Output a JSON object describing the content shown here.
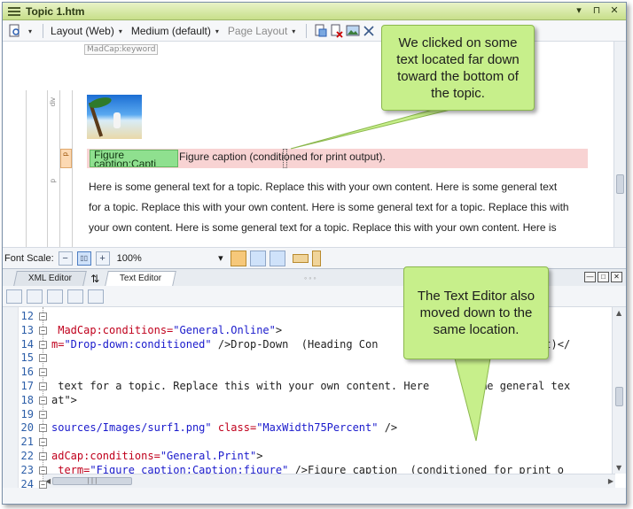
{
  "window": {
    "title": "Topic 1.htm",
    "controls": {
      "dropdown": "▾",
      "pin": "⊓",
      "close": "✕"
    }
  },
  "toolbar": {
    "layout": "Layout (Web)",
    "medium": "Medium (default)",
    "page_layout": "Page Layout"
  },
  "wysiwyg": {
    "keyword_tag": "MadCap:keyword",
    "struct_tags": [
      "div",
      "p",
      "p"
    ],
    "caption_label": "Figure caption;Capti",
    "caption_text": "Figure caption (conditioned for print output).",
    "body_lines": [
      "Here is some general text for a topic. Replace this with your own content. Here is some general text",
      "for a topic. Replace this with your own content. Here is some general text for a topic. Replace this with",
      "your own content. Here is some general text for a topic. Replace this with your own content. Here is"
    ]
  },
  "scalebar": {
    "label": "Font Scale:",
    "zoom": "100%",
    "minus": "−",
    "plus": "+",
    "zoom_arrow": "▾"
  },
  "lower_pane": {
    "tabs": [
      "XML Editor",
      "Text Editor"
    ],
    "active_tab": "Text Editor",
    "swap_icon": "⇅",
    "grip": "◦◦◦",
    "pane_controls": [
      "—",
      "□",
      "✕"
    ]
  },
  "code": {
    "line_numbers": [
      "12",
      "13",
      "14",
      "15",
      "16",
      "17",
      "18",
      "19",
      "20",
      "21",
      "22",
      "23",
      "24"
    ],
    "lines": [
      [],
      [
        {
          "t": " MadCap:conditions=",
          "c": "attr"
        },
        {
          "t": "\"General.Online\"",
          "c": "str"
        },
        {
          "t": ">",
          "c": ""
        }
      ],
      [
        {
          "t": "m=",
          "c": "attr"
        },
        {
          "t": "\"Drop-down:conditioned\"",
          "c": "str"
        },
        {
          "t": " />Drop-Down  (Heading Con",
          "c": ""
        },
        {
          "t": "                      utput)</",
          "c": ""
        }
      ],
      [],
      [],
      [
        {
          "t": " text for a topic. Replace this with your own content. Here",
          "c": ""
        },
        {
          "t": "      some general tex",
          "c": ""
        }
      ],
      [
        {
          "t": "at\">",
          "c": ""
        }
      ],
      [],
      [
        {
          "t": "sources/Images/surf1.png\"",
          "c": "str"
        },
        {
          "t": " class=",
          "c": "attr"
        },
        {
          "t": "\"MaxWidth75Percent\"",
          "c": "str"
        },
        {
          "t": " />",
          "c": ""
        }
      ],
      [],
      [
        {
          "t": "adCap:conditions=",
          "c": "attr"
        },
        {
          "t": "\"General.Print\"",
          "c": "str"
        },
        {
          "t": ">",
          "c": ""
        }
      ],
      [
        {
          "t": " term=",
          "c": "attr"
        },
        {
          "t": "\"Figure caption;Caption:figure\"",
          "c": "str"
        },
        {
          "t": " />Figure caption  (conditioned for print o",
          "c": ""
        }
      ],
      []
    ],
    "scroll_grip": "|||"
  },
  "callouts": {
    "top": "We clicked on some text located far down toward the bottom of the topic.",
    "bottom": "The Text Editor also moved down to the same location."
  },
  "colors": {
    "titlebar": "#c7df8a",
    "callout": "#c7ef8b",
    "caption_highlight": "#f8d3d3",
    "caption_label": "#8fe08f",
    "attr": "#c0001c",
    "string": "#1a1acc",
    "line_number": "#2c5ea8"
  }
}
